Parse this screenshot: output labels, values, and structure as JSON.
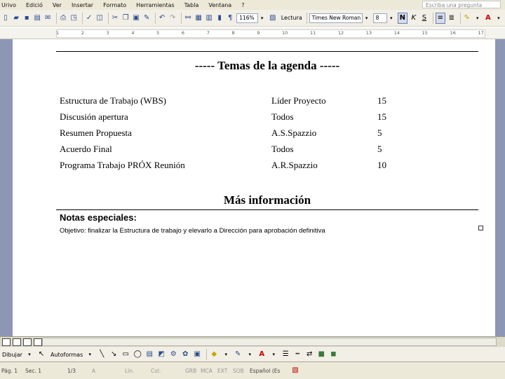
{
  "menu": {
    "items": [
      "Urivo",
      "Edició",
      "Ver",
      "Insertar",
      "Formato",
      "Herramientas",
      "Tabla",
      "Ventana",
      "?"
    ],
    "help_placeholder": "Escriba una pregunta"
  },
  "toolbar": {
    "zoom": "116%",
    "reading_label": "Lectura",
    "font_name": "Times New Roman",
    "font_size": "8",
    "bold_label": "N",
    "italic_label": "K",
    "underline_label": "S"
  },
  "ruler": {
    "ticks": [
      "1",
      "2",
      "3",
      "4",
      "5",
      "6",
      "7",
      "8",
      "9",
      "10",
      "11",
      "12",
      "13",
      "14",
      "15",
      "16",
      "17"
    ]
  },
  "document": {
    "agenda_heading": "----- Temas de la agenda -----",
    "agenda_rows": [
      {
        "topic": "Estructura de Trabajo (WBS)",
        "owner": "Líder Proyecto",
        "minutes": "15"
      },
      {
        "topic": "Discusión apertura",
        "owner": "Todos",
        "minutes": "15"
      },
      {
        "topic": "Resumen Propuesta",
        "owner": "A.S.Spazzio",
        "minutes": "5"
      },
      {
        "topic": "Acuerdo Final",
        "owner": "Todos",
        "minutes": "5"
      },
      {
        "topic": "Programa Trabajo PRÓX Reunión",
        "owner": "A.R.Spazzio",
        "minutes": "10"
      }
    ],
    "more_info_heading": "Más información",
    "notes_title": "Notas especiales:",
    "notes_body": "Objetivo: finalizar la Estructura de trabajo y elevarlo a Dirección para aprobación definitiva"
  },
  "draw_toolbar": {
    "draw_label": "Dibujar",
    "autoshapes_label": "Autoformas"
  },
  "status": {
    "page": "Pág. 1",
    "section": "Sec. 1",
    "page_count": "1/3",
    "at": "A",
    "line": "Lín.",
    "col": "Col.",
    "grb": "GRB",
    "mca": "MCA",
    "ext": "EXT",
    "sob": "SOB",
    "language": "Español (Es"
  }
}
